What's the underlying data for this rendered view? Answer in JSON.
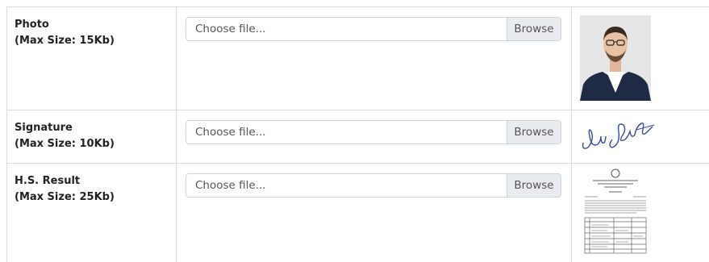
{
  "rows": [
    {
      "title": "Photo",
      "max_size": "(Max Size: 15Kb)",
      "placeholder": "Choose file...",
      "browse_label": "Browse",
      "preview": "photo"
    },
    {
      "title": "Signature",
      "max_size": "(Max Size: 10Kb)",
      "placeholder": "Choose file...",
      "browse_label": "Browse",
      "preview": "signature"
    },
    {
      "title": "H.S. Result",
      "max_size": "(Max Size: 25Kb)",
      "placeholder": "Choose file...",
      "browse_label": "Browse",
      "preview": "document"
    }
  ],
  "colors": {
    "border": "#dcdcdc",
    "input_border": "#ced4da",
    "browse_bg": "#e9ecef",
    "signature_ink": "#3a4aa0",
    "jacket": "#1f2a44"
  }
}
